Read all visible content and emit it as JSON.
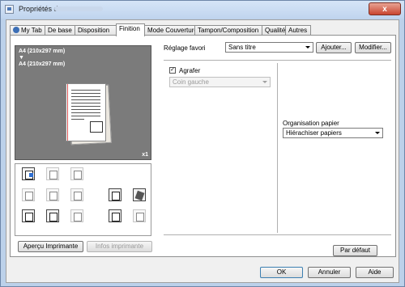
{
  "window": {
    "title": "Propriétés de :",
    "close_glyph": "x"
  },
  "tabs": [
    {
      "label": "My Tab",
      "icon": "user-icon"
    },
    {
      "label": "De base"
    },
    {
      "label": "Disposition"
    },
    {
      "label": "Finition",
      "active": true
    },
    {
      "label": "Mode Couverture"
    },
    {
      "label": "Tampon/Composition"
    },
    {
      "label": "Qualité"
    },
    {
      "label": "Autres"
    }
  ],
  "preview": {
    "paper_top": "A4 (210x297 mm)",
    "arrow": "▼",
    "paper_bottom": "A4 (210x297 mm)",
    "copies": "x1"
  },
  "left_buttons": {
    "print_preview": "Aperçu Imprimante",
    "printer_info": "Infos imprimante"
  },
  "favorite": {
    "label": "Réglage favori",
    "value": "Sans titre",
    "add": "Ajouter...",
    "modify": "Modifier..."
  },
  "staple": {
    "label": "Agrafer",
    "checked": true,
    "position": "Coin gauche"
  },
  "paper_org": {
    "label": "Organisation papier",
    "value": "Hiérachiser papiers"
  },
  "default_button": "Par défaut",
  "dialog_buttons": {
    "ok": "OK",
    "cancel": "Annuler",
    "help": "Aide"
  },
  "colors": {
    "accent": "#2f6fd1",
    "frame": "#bcd1ea"
  }
}
